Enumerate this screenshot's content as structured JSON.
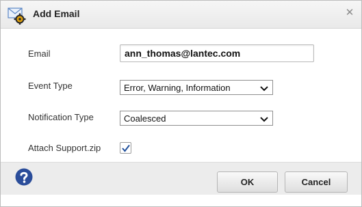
{
  "dialog": {
    "title": "Add Email",
    "title_icon": "email-settings-icon",
    "close_glyph": "✕"
  },
  "form": {
    "email_label": "Email",
    "email_value": "ann_thomas@lantec.com",
    "event_type_label": "Event Type",
    "event_type_value": "Error, Warning, Information",
    "notification_type_label": "Notification Type",
    "notification_type_value": "Coalesced",
    "attach_label": "Attach Support.zip",
    "attach_checked": true
  },
  "footer": {
    "help_icon": "help-icon",
    "ok_label": "OK",
    "cancel_label": "Cancel"
  },
  "colors": {
    "help_icon_bg": "#2b4d9a",
    "gear_color": "#e0a10c"
  }
}
